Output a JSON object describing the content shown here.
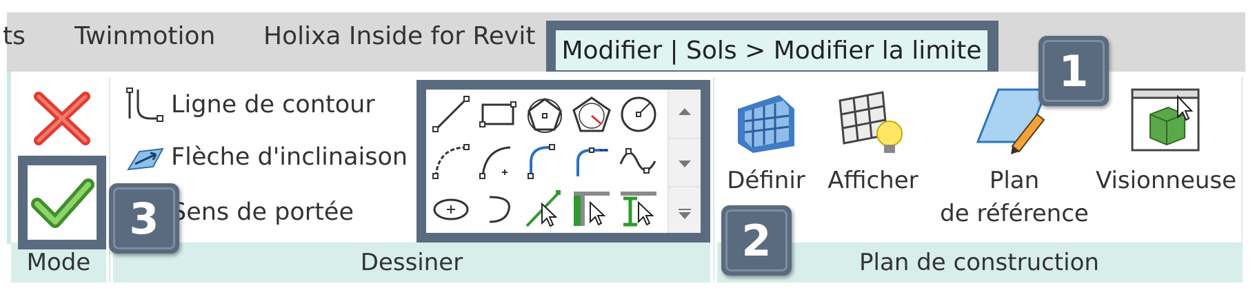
{
  "tabs": {
    "partial": "ts",
    "twinmotion": "Twinmotion",
    "holixa": "Holixa Inside for Revit",
    "active": "Modifier | Sols > Modifier la limite"
  },
  "panels": {
    "mode": {
      "title": "Mode",
      "cancel_icon": "red-x-icon",
      "finish_icon": "green-check-icon"
    },
    "dessiner": {
      "title": "Dessiner",
      "commands": [
        {
          "label": "Ligne de contour",
          "icon": "boundary-line-icon"
        },
        {
          "label": "Flèche d'inclinaison",
          "icon": "slope-arrow-icon"
        },
        {
          "label": "Sens de portée",
          "icon": "span-direction-icon"
        }
      ],
      "gallery_icons": [
        "line-icon",
        "rectangle-icon",
        "inscribed-polygon-icon",
        "circumscribed-polygon-icon",
        "circle-icon",
        "start-end-arc-icon",
        "center-end-arc-icon",
        "tangent-arc-icon",
        "fillet-arc-icon",
        "spline-icon",
        "ellipse-icon",
        "partial-ellipse-icon",
        "pick-lines-icon",
        "pick-walls-icon",
        "pick-supports-icon"
      ]
    },
    "plan_construction": {
      "title": "Plan de construction",
      "buttons": [
        {
          "label": "Définir",
          "icon": "set-workplane-icon"
        },
        {
          "label": "Afficher",
          "icon": "show-workplane-icon"
        },
        {
          "label_line1": "Plan",
          "label_line2": "de référence",
          "icon": "reference-plane-icon"
        },
        {
          "label": "Visionneuse",
          "icon": "viewer-icon"
        }
      ]
    }
  },
  "callouts": [
    "1",
    "2",
    "3"
  ],
  "colors": {
    "callout": "#5a6b80",
    "panel_footer": "#d7eeeb",
    "active_tab": "#e0f4f1",
    "cancel": "#e23b2e",
    "finish": "#5fae3b"
  }
}
